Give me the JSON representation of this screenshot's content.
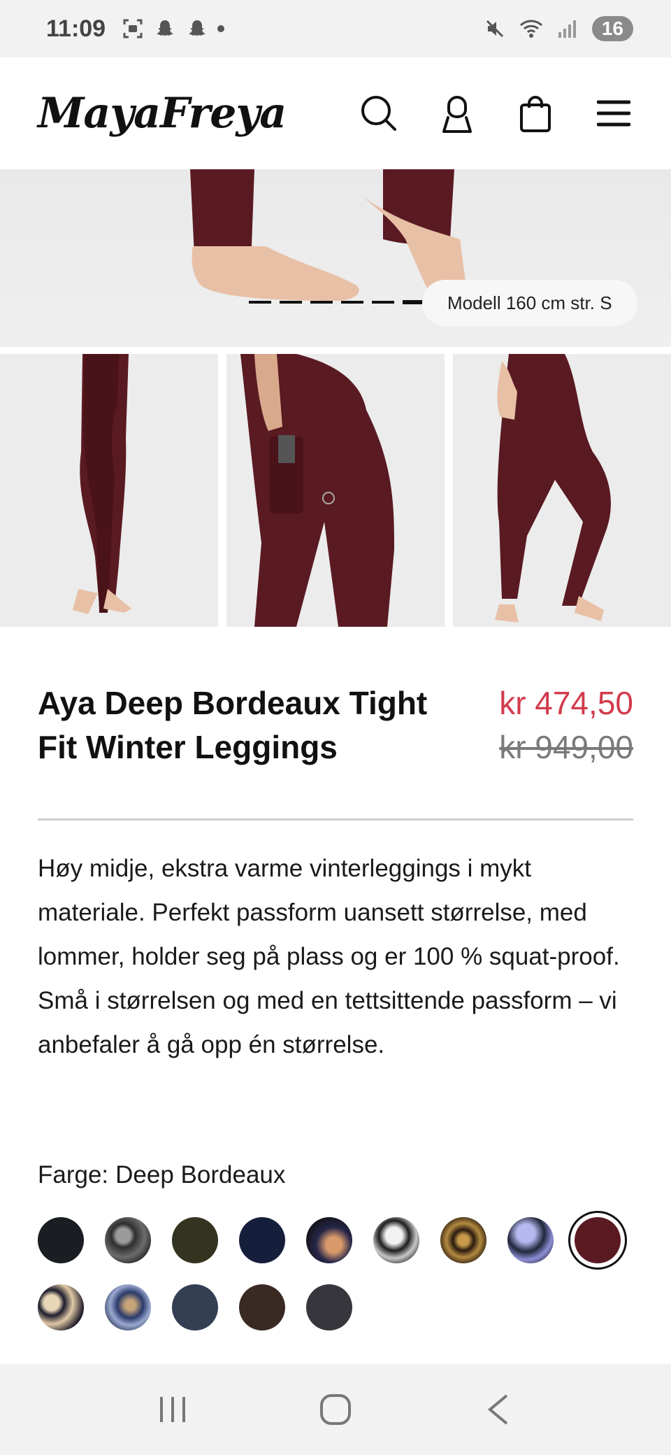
{
  "status_bar": {
    "time": "11:09",
    "battery": "16"
  },
  "header": {
    "logo": "MayaFreya"
  },
  "hero": {
    "caption": "Modell 160 cm str. S",
    "slide_count": 6,
    "active_slide": 6
  },
  "product": {
    "title": "Aya Deep Bordeaux Tight Fit Winter Leggings",
    "price_sale": "kr 474,50",
    "price_original": "kr 949,00",
    "description": "Høy midje, ekstra varme vinterleggings i mykt materiale. Perfekt passform uansett størrelse, med lommer, holder seg på plass og er 100 % squat-proof. Små i størrelsen og med en tettsittende passform – vi anbefaler å gå opp én størrelse.",
    "color_label": "Farge:",
    "color_value": "Deep Bordeaux"
  },
  "colors": {
    "accent_sale": "#d23b4c",
    "garment": "#5a1a22"
  }
}
